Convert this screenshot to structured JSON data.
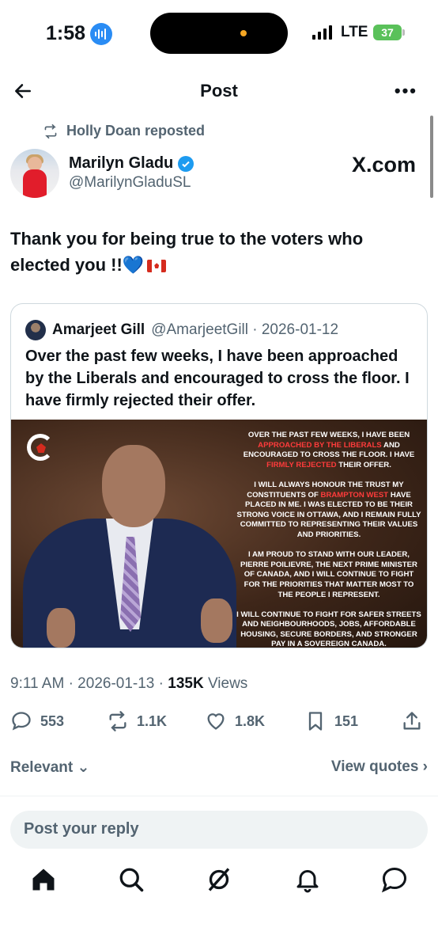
{
  "status": {
    "time": "1:58",
    "network": "LTE",
    "battery": "37"
  },
  "header": {
    "title": "Post",
    "more": "•••"
  },
  "repost": {
    "label": "Holly Doan reposted"
  },
  "author": {
    "name": "Marilyn Gladu",
    "handle": "@MarilynGladuSL",
    "badge": "X.com"
  },
  "tweet": {
    "text": "Thank you for being true to the voters who elected you !!💙"
  },
  "quote": {
    "name": "Amarjeet Gill",
    "handle_date": "@AmarjeetGill · 2026-01-12",
    "text": "Over the past few weeks, I have been approached by the Liberals and encouraged to cross the floor. I have firmly rejected their offer.",
    "image_text": {
      "p1a": "Over the past few weeks, I have been ",
      "p1b": "approached by the Liberals",
      "p1c": " and encouraged to cross the floor. I have ",
      "p1d": "firmly rejected",
      "p1e": " their offer.",
      "p2a": "I will always honour the trust my constituents of ",
      "p2b": "Brampton West",
      "p2c": " have placed in me. I was elected to be their strong voice in Ottawa, and I remain fully committed to representing their values and priorities.",
      "p3": "I am proud to stand with our leader, Pierre Poilievre, the next Prime Minister of Canada, and I will continue to fight for the priorities that matter most to the people I represent.",
      "p4": "I will continue to fight for safer streets and neighbourhoods, jobs, affordable housing, secure borders, and stronger pay in a sovereign Canada."
    }
  },
  "meta": {
    "time_date": "9:11 AM · 2026-01-13 · ",
    "views_count": "135K",
    "views_label": " Views"
  },
  "actions": {
    "replies": "553",
    "reposts": "1.1K",
    "likes": "1.8K",
    "bookmarks": "151"
  },
  "sort": {
    "relevant": "Relevant",
    "view_quotes": "View quotes"
  },
  "reply": {
    "placeholder": "Post your reply"
  },
  "colors": {
    "accent": "#1d9bf0",
    "text": "#0f1419",
    "muted": "#536471",
    "red_highlight": "#ff3b3b"
  },
  "icons": [
    "back-arrow-icon",
    "more-icon",
    "repost-icon",
    "verified-icon",
    "reply-icon",
    "like-icon",
    "bookmark-icon",
    "share-icon",
    "home-icon",
    "search-icon",
    "grok-icon",
    "notifications-icon",
    "messages-icon"
  ]
}
